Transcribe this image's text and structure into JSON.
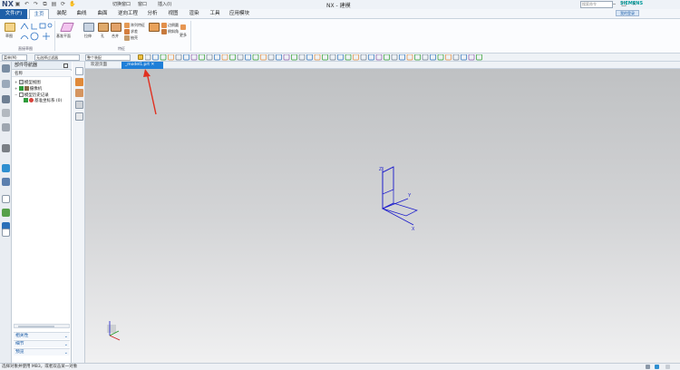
{
  "titlebar": {
    "logo": "NX",
    "quick_access_icons": [
      "save-icon",
      "undo-icon",
      "redo-icon",
      "copy-icon",
      "paste-icon",
      "repeat-icon",
      "touch-mode-icon"
    ],
    "switch_window": "切换窗口",
    "window_menu": "窗口",
    "insert_menu": "插入(I)",
    "title": "NX - 建模",
    "window_buttons": [
      "—",
      "□",
      "✕"
    ],
    "siemens": "SIEMENS"
  },
  "menubar": {
    "file": "文件(F)",
    "tabs": [
      "主页",
      "装配",
      "曲线",
      "曲面",
      "逆向工程",
      "分析",
      "视图",
      "渲染",
      "工具",
      "应用模块"
    ],
    "active_tab": "主页",
    "search_placeholder": "搜索命令",
    "login": "我的登录"
  },
  "ribbon": {
    "sketch_label": "草图",
    "direct_sketch_group": "直接草图",
    "datum_plane": "基准平面",
    "extrude": "拉伸",
    "hole": "孔",
    "unite": "合并",
    "pattern_feature": "阵列特征",
    "subtract": "求差",
    "shell": "抽壳",
    "edge_blend": "边倒圆",
    "chamfer": "倒斜角",
    "more": "更多",
    "feature_group": "特征"
  },
  "toolbar2": {
    "menu": "菜单(M)",
    "selection_filter": "无选择过滤器",
    "assembly_scope": "整个装配"
  },
  "navigator": {
    "title": "部件导航器",
    "column_header": "名称",
    "items": [
      {
        "label": "模型视图"
      },
      {
        "label": "摄像机"
      },
      {
        "label": "模型历史记录"
      },
      {
        "label": "基准坐标系 (0)"
      }
    ],
    "accordion": [
      "相关性",
      "细节",
      "预览"
    ]
  },
  "doctabs": {
    "welcome": "欢迎页面",
    "active": "_model1.prt"
  },
  "viewport": {
    "axes": {
      "x": "X",
      "y": "Y",
      "z": "Z"
    }
  },
  "status": {
    "message": "选择对象并使用 MB3，或者双击某一对象"
  },
  "colors": {
    "accent": "#1f5fa8",
    "active_tab": "#1f7fd8",
    "annotation": "#e03020",
    "datum": "#1a1acc"
  }
}
